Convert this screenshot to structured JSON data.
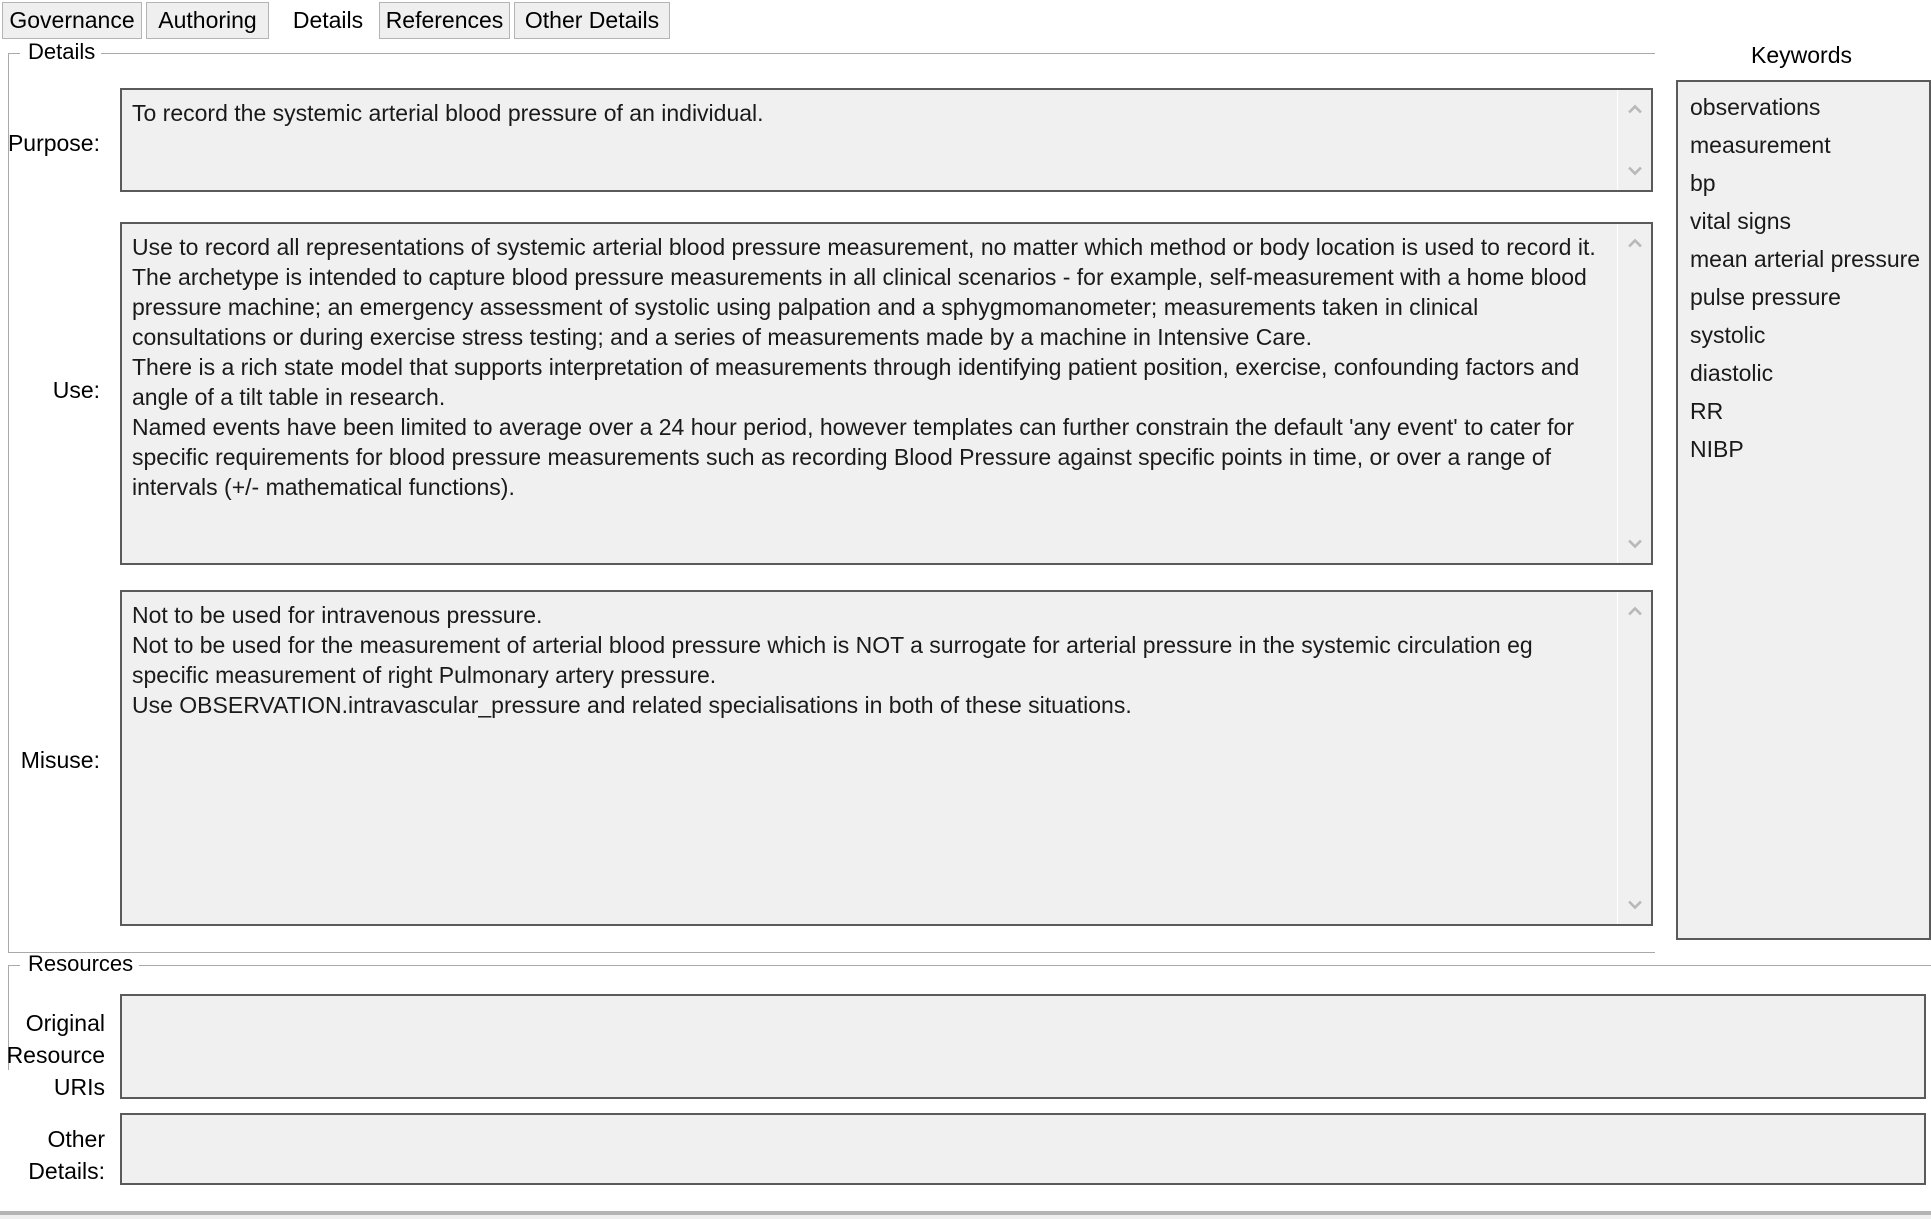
{
  "tabs": [
    {
      "label": "Governance",
      "active": false
    },
    {
      "label": "Authoring",
      "active": false
    },
    {
      "label": "Details",
      "active": true
    },
    {
      "label": "References",
      "active": false
    },
    {
      "label": "Other Details",
      "active": false
    }
  ],
  "details_group": {
    "title": "Details",
    "purpose": {
      "label": "Purpose:",
      "value": "To record the systemic arterial blood pressure of an individual."
    },
    "use": {
      "label": "Use:",
      "value": "Use to record all representations of systemic arterial blood pressure measurement, no matter which method or body location is used to record it. The archetype is intended to capture blood pressure measurements in all clinical scenarios - for example, self-measurement with a home blood pressure machine; an emergency assessment of systolic using palpation and a sphygmomanometer; measurements taken in clinical consultations or during exercise stress testing; and a series of measurements made by a machine in Intensive Care.\nThere is a rich state model that supports interpretation of measurements through identifying patient position, exercise, confounding factors and angle of a tilt table in research.\nNamed events have been limited to average over a 24 hour period, however templates can further constrain the default 'any event' to cater for specific requirements for blood pressure measurements such as recording Blood Pressure against specific points in time, or over a range of intervals (+/- mathematical functions)."
    },
    "misuse": {
      "label": "Misuse:",
      "value": "Not to be used for intravenous pressure.\nNot to be used for the measurement of arterial blood pressure which is NOT a surrogate for arterial pressure in the systemic circulation eg specific measurement of right Pulmonary artery pressure.\nUse OBSERVATION.intravascular_pressure and related specialisations in both of these situations."
    }
  },
  "keywords": {
    "title": "Keywords",
    "items": [
      "observations",
      "measurement",
      "bp",
      "vital signs",
      "mean arterial pressure",
      "pulse pressure",
      "systolic",
      "diastolic",
      "RR",
      "NIBP"
    ]
  },
  "resources_group": {
    "title": "Resources",
    "original_resource_uris": {
      "label": "Original\nResource\nURIs",
      "value": ""
    },
    "other_details": {
      "label": "Other\nDetails:",
      "value": ""
    }
  },
  "icons": {
    "scroll_up": "chevron-up-icon",
    "scroll_down": "chevron-down-icon"
  },
  "colors": {
    "window_bg": "#ffffff",
    "field_bg": "#f0f0f0",
    "field_border": "#5a5a5a",
    "group_border": "#a9a9a9",
    "tab_bg": "#efefef",
    "tab_border": "#b4b4b4",
    "text": "#1a1a1a",
    "scroll_arrow": "#b8b8b8"
  }
}
